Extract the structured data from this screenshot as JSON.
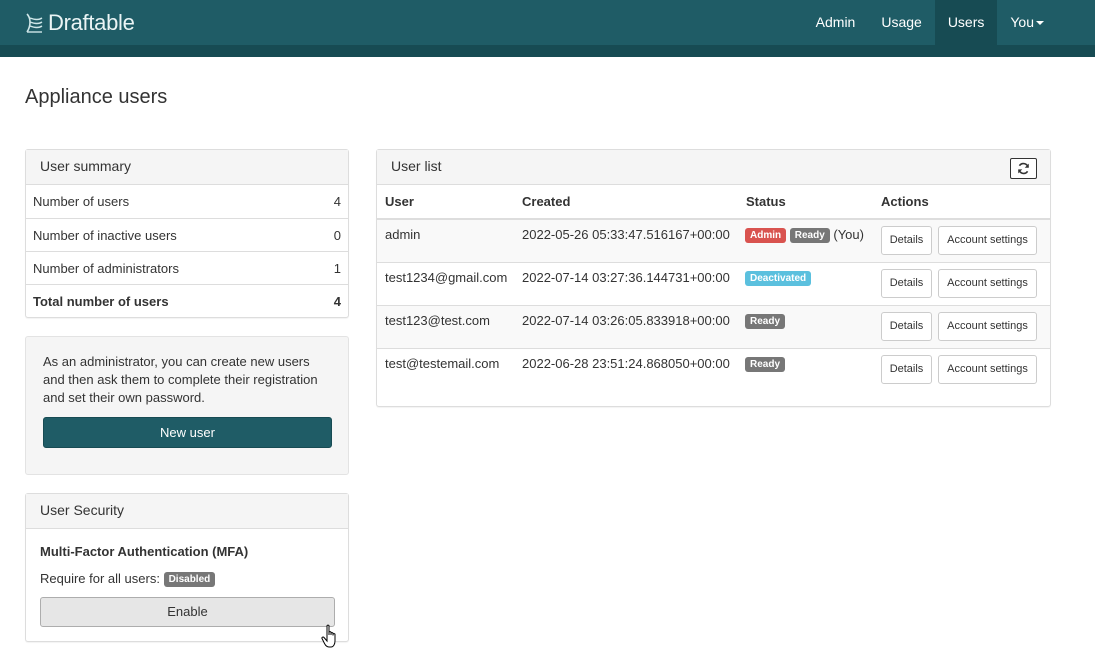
{
  "app": {
    "brand": "Draftable"
  },
  "nav": {
    "items": [
      {
        "label": "Admin"
      },
      {
        "label": "Usage"
      },
      {
        "label": "Users"
      },
      {
        "label": "You"
      }
    ]
  },
  "page": {
    "title": "Appliance users"
  },
  "summary": {
    "heading": "User summary",
    "rows": [
      {
        "label": "Number of users",
        "value": "4"
      },
      {
        "label": "Number of inactive users",
        "value": "0"
      },
      {
        "label": "Number of administrators",
        "value": "1"
      },
      {
        "label": "Total number of users",
        "value": "4"
      }
    ]
  },
  "create": {
    "text": "As an administrator, you can create new users and then ask them to complete their registration and set their own password.",
    "button": "New user"
  },
  "security": {
    "heading": "User Security",
    "mfa_title": "Multi-Factor Authentication (MFA)",
    "require_label": "Require for all users:",
    "status_badge": "Disabled",
    "enable_button": "Enable"
  },
  "userlist": {
    "heading": "User list",
    "refresh_icon": "refresh-icon",
    "columns": {
      "user": "User",
      "created": "Created",
      "status": "Status",
      "actions": "Actions"
    },
    "details_label": "Details",
    "settings_label": "Account settings",
    "rows": [
      {
        "user": "admin",
        "created": "2022-05-26 05:33:47.516167+00:00",
        "badge1": "Admin",
        "badge2": "Ready",
        "suffix": "(You)"
      },
      {
        "user": "test1234@gmail.com",
        "created": "2022-07-14 03:27:36.144731+00:00",
        "badge1": "Deactivated"
      },
      {
        "user": "test123@test.com",
        "created": "2022-07-14 03:26:05.833918+00:00",
        "badge1": "Ready"
      },
      {
        "user": "test@testemail.com",
        "created": "2022-06-28 23:51:24.868050+00:00",
        "badge1": "Ready"
      }
    ]
  },
  "colors": {
    "brand": "#1f5c66",
    "danger": "#d9534f",
    "info": "#5bc0de",
    "default": "#777777"
  }
}
